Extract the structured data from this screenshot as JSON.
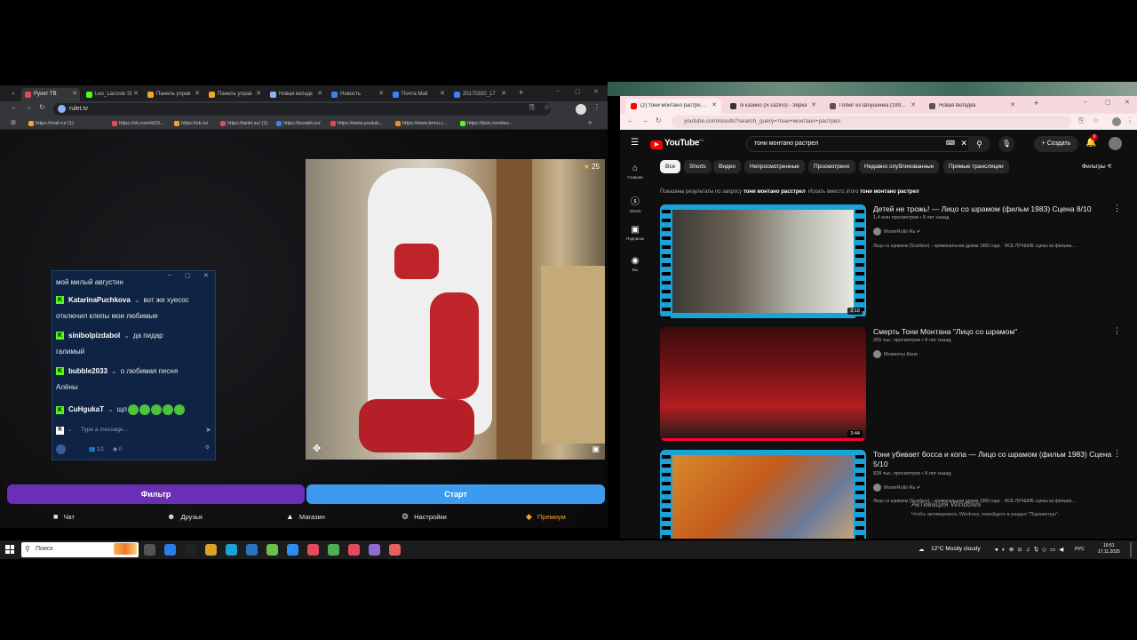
{
  "left_browser": {
    "tabs": [
      {
        "label": "Рулет ТВ",
        "active": true,
        "color": "#e34b5d"
      },
      {
        "label": "Leo_Lacoste St",
        "active": false,
        "color": "#53fc18"
      },
      {
        "label": "Панель управ",
        "active": false,
        "color": "#f5a623"
      },
      {
        "label": "Панель управ",
        "active": false,
        "color": "#f5a623"
      },
      {
        "label": "Новая вкладк",
        "active": false,
        "color": "#8ab4f8"
      },
      {
        "label": "Новость",
        "active": false,
        "color": "#3b82f6"
      },
      {
        "label": "Почта Mail",
        "active": false,
        "color": "#3b82f6"
      },
      {
        "label": "20170330_17",
        "active": false,
        "color": "#3b82f6"
      }
    ],
    "url": "rulet.tv",
    "bookmarks": [
      {
        "label": "https://mail.ru/ (1)",
        "color": "#f5a623"
      },
      {
        "label": "https://vk.com/id19...",
        "color": "#e34b5d"
      },
      {
        "label": "https://ok.ru/",
        "color": "#f5a623"
      },
      {
        "label": "https://tanki.su/ (1)",
        "color": "#e34b5d"
      },
      {
        "label": "https://korabli.su/",
        "color": "#3b82f6"
      },
      {
        "label": "https://www.youtub...",
        "color": "#e34b5d"
      },
      {
        "label": "https://www.temu.c...",
        "color": "#f58a1f"
      },
      {
        "label": "https://kick.com/leo...",
        "color": "#53fc18"
      }
    ],
    "video": {
      "star_count": "25"
    },
    "chat": {
      "messages": [
        {
          "user": "",
          "text": "мой милый августин"
        },
        {
          "user": "KatarinaPuchkova",
          "text": "вот же хуесос",
          "cont": "отключил клипы мои любимые"
        },
        {
          "user": "sinibolpizdabol",
          "text": "да пидар",
          "cont": "галимый"
        },
        {
          "user": "bubble2033",
          "text": "о любимая песня",
          "cont": "Алёны"
        },
        {
          "user": "CuHgukaT",
          "text": "щл",
          "cont": ""
        }
      ],
      "input_placeholder": "Type a message...",
      "viewer_count": "1/1",
      "watch_count": "0"
    },
    "buttons": {
      "filter": "Фильтр",
      "start": "Старт"
    },
    "bottom_nav": {
      "chat": "Чат",
      "friends": "Друзья",
      "shop": "Магазин",
      "settings": "Настройки",
      "premium": "Премиум"
    }
  },
  "right_browser": {
    "tabs": [
      {
        "label": "(2) тони монтано растрел - Yo",
        "active": true,
        "color": "#ff0000"
      },
      {
        "label": "/к казино (/к cazino) - Зерка",
        "active": false,
        "color": "#333333"
      },
      {
        "label": "Побег из Шоушенка (1994) см",
        "active": false,
        "color": "#555555"
      },
      {
        "label": "Новая вкладка",
        "active": false,
        "color": "#555555"
      }
    ],
    "url": "youtube.com/results?search_query=тони+монтано+растрел",
    "youtube": {
      "logo": "YouTube",
      "logo_sup": "RU",
      "search_value": "тони монтано растрел",
      "create_label": "Создать",
      "notif_count": "9",
      "sidebar": [
        {
          "icon": "⌂",
          "label": "Главная"
        },
        {
          "icon": "ⓢ",
          "label": "Shorts"
        },
        {
          "icon": "▣",
          "label": "Подписки"
        },
        {
          "icon": "◉",
          "label": "Вы"
        }
      ],
      "chips": [
        {
          "label": "Все",
          "active": true
        },
        {
          "label": "Shorts",
          "active": false
        },
        {
          "label": "Видео",
          "active": false
        },
        {
          "label": "Непросмотренные",
          "active": false
        },
        {
          "label": "Просмотрено",
          "active": false
        },
        {
          "label": "Недавно опубликованные",
          "active": false
        },
        {
          "label": "Прямые трансляции",
          "active": false
        }
      ],
      "filters_label": "Фильтры",
      "hint_prefix": "Показаны результаты по запросу",
      "hint_query": "тони монтано расстрел",
      "hint_alt_prefix": "Искать вместо этого",
      "hint_alt": "тони монтано растрел",
      "videos": [
        {
          "title": "Детей не трожь! — Лицо со шрамом (фильм 1983) Сцена 8/10",
          "meta": "1,4 млн просмотров • 8 лет назад",
          "channel": "MovieRolls Ru",
          "desc": "Лицо со шрамом (Scarface) – криминальная драма 1983 года. · ВСЕ ЛУЧШИЕ сцены из фильма ...",
          "duration": "3:18"
        },
        {
          "title": "Смерть Тони Монтана \"Лицо со шрамом\"",
          "meta": "265 тыс. просмотров • 8 лет назад",
          "channel": "Моменты Кино",
          "desc": "",
          "duration": "3:44"
        },
        {
          "title": "Тони убивает босса и копа — Лицо со шрамом (фильм 1983) Сцена 5/10",
          "meta": "828 тыс. просмотров • 8 лет назад",
          "channel": "MovieRolls Ru",
          "desc": "Лицо со шрамом (Scarface) – криминальная драма 1983 года. · ВСЕ ЛУЧШИЕ сцены из фильма ...",
          "duration": ""
        }
      ]
    },
    "watermark": {
      "title": "Активация Windows",
      "sub": "Чтобы активировать Windows, перейдите в раздел \"Параметры\"."
    }
  },
  "taskbar": {
    "search_placeholder": "Поиск",
    "weather": "12°C  Mostly cloudy",
    "lang": "РУС",
    "time": "16:51",
    "date": "17.11.2025"
  }
}
